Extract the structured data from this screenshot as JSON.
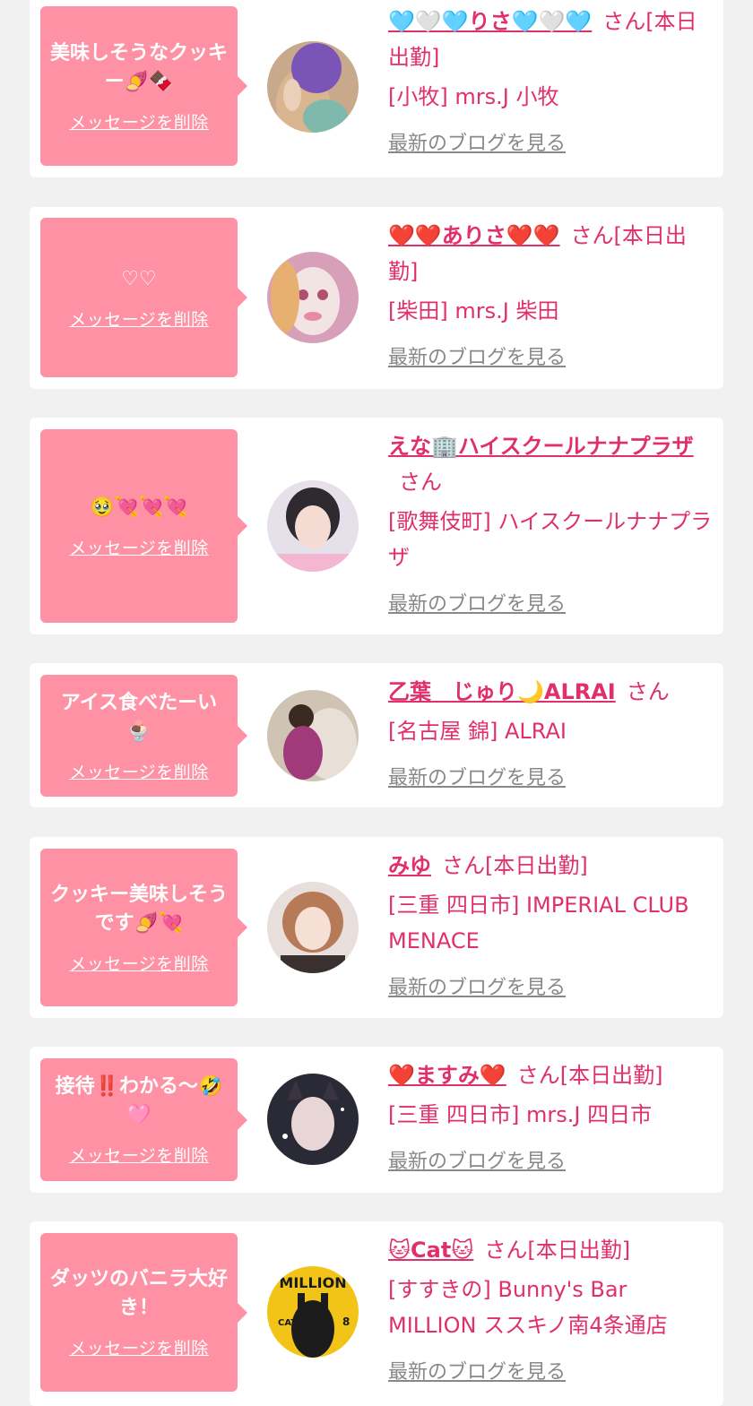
{
  "delete_label": "メッセージを削除",
  "blog_label": "最新のブログを見る",
  "cards": [
    {
      "message": "美味しそうなクッキー🍠🍫",
      "name": "🩵🤍🩵りさ🩵🤍🩵",
      "suffix": "さん[本日出勤]",
      "shop": "[小牧] mrs.J 小牧"
    },
    {
      "message": "♡♡",
      "name": "❤️❤️ありさ❤️❤️",
      "suffix": "さん[本日出勤]",
      "shop": "[柴田] mrs.J 柴田"
    },
    {
      "message": "🥹💘💘💘",
      "name": "えな🏢ハイスクールナナプラザ",
      "suffix": "さん",
      "shop": "[歌舞伎町] ハイスクールナナプラザ"
    },
    {
      "message": "アイス食べたーい🍨",
      "name": "乙葉　じゅり🌙ALRAI",
      "suffix": "さん",
      "shop": "[名古屋 錦] ALRAI"
    },
    {
      "message": "クッキー美味しそうです🍠💘",
      "name": "みゆ",
      "suffix": "さん[本日出勤]",
      "shop": "[三重 四日市] IMPERIAL CLUB MENACE"
    },
    {
      "message": "接待‼️わかる〜🤣🩷",
      "name": "❤️ますみ❤️",
      "suffix": "さん[本日出勤]",
      "shop": "[三重 四日市] mrs.J 四日市"
    },
    {
      "message": "ダッツのバニラ大好き！",
      "name": "🐱Cat🐱",
      "suffix": "さん[本日出勤]",
      "shop": "[すすきの] Bunny's Bar MILLION ススキノ南4条通店"
    }
  ],
  "avatar_badges": {
    "cat_label": "CAT",
    "cat_number": "8",
    "million": "MILLION"
  },
  "colors": {
    "background": "#f1f1f1",
    "bubble": "#ff91a4",
    "accent": "#e0306a",
    "muted": "#888888"
  }
}
